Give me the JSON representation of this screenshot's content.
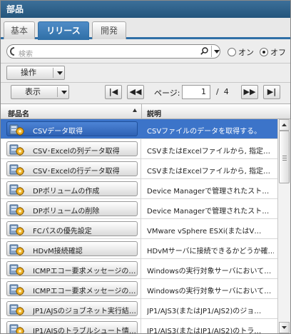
{
  "window": {
    "title": "部品"
  },
  "tabs": [
    {
      "label": "基本",
      "active": false
    },
    {
      "label": "リリース",
      "active": true
    },
    {
      "label": "開発",
      "active": false
    }
  ],
  "search": {
    "placeholder": "検索",
    "scope_on_label": "オン",
    "scope_off_label": "オフ",
    "scope_selected": "オフ"
  },
  "toolbar": {
    "operation_label": "操作",
    "display_label": "表示"
  },
  "pager": {
    "page_label": "ページ:",
    "current_page": "1",
    "separator": "/",
    "total_pages": "4"
  },
  "table": {
    "columns": [
      {
        "label": "部品名",
        "sort": "ascending"
      },
      {
        "label": "説明"
      }
    ],
    "rows": [
      {
        "name": "CSVデータ取得",
        "description": "CSVファイルのデータを取得する。",
        "selected": true
      },
      {
        "name": "CSV･Excelの列データ取得",
        "description": "CSVまたはExcelファイルから, 指定…",
        "selected": false
      },
      {
        "name": "CSV･Excelの行データ取得",
        "description": "CSVまたはExcelファイルから, 指定…",
        "selected": false
      },
      {
        "name": "DPボリュームの作成",
        "description": "Device Managerで管理されたスト…",
        "selected": false
      },
      {
        "name": "DPボリュームの削除",
        "description": "Device Managerで管理されたスト…",
        "selected": false
      },
      {
        "name": "FCパスの優先設定",
        "description": "VMware vSphere ESXi(またはV…",
        "selected": false
      },
      {
        "name": "HDvM接続確認",
        "description": "HDvMサーバに接続できるかどうか確…",
        "selected": false
      },
      {
        "name": "ICMPエコー要求メッセージの…",
        "description": "Windowsの実行対象サーバにおいて…",
        "selected": false
      },
      {
        "name": "ICMPエコー要求メッセージの…",
        "description": "Windowsの実行対象サーバにおいて…",
        "selected": false
      },
      {
        "name": "JP1/AJSのジョブネット実行結…",
        "description": "JP1/AJS3(またはJP1/AJS2)のジョ…",
        "selected": false
      },
      {
        "name": "JP1/AJSのトラブルシュート情…",
        "description": "JP1/AJS3(またはJP1/AJS2)のトラ…",
        "selected": false
      }
    ]
  },
  "scrollbar": {
    "position_fraction": 0.0
  },
  "colors": {
    "title_bar": "#2c5f87",
    "active_tab": "#2f6fa6",
    "selection": "#3c74c9"
  },
  "icons": {
    "tab_strip": "none",
    "row_icon": "gear-server-icon",
    "search_magnifier": "magnifier-icon"
  }
}
